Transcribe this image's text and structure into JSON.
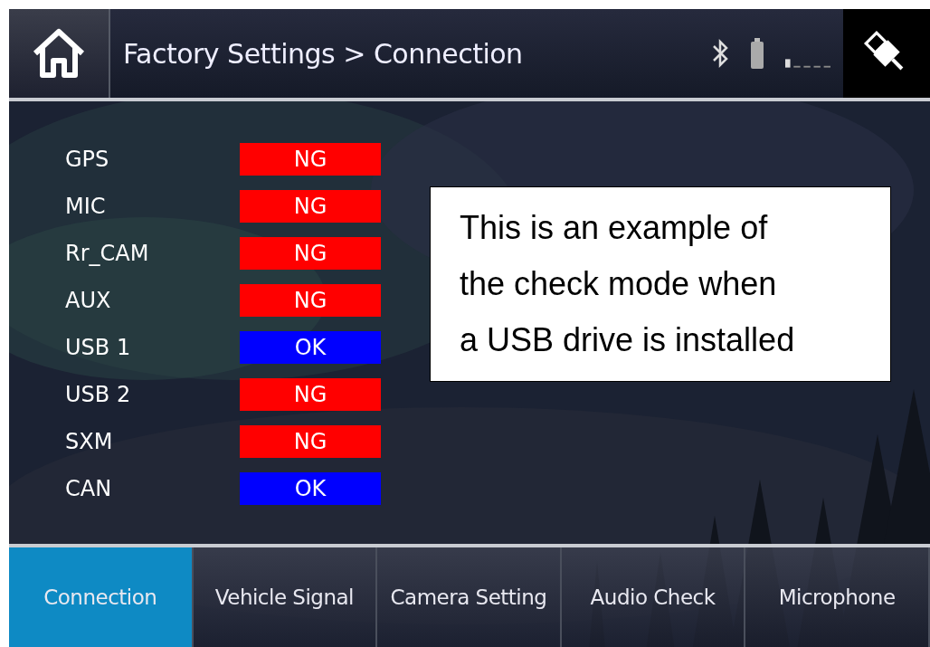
{
  "header": {
    "breadcrumb": "Factory Settings > Connection"
  },
  "checks": [
    {
      "label": "GPS",
      "status": "NG",
      "color": "#ff0000"
    },
    {
      "label": "MIC",
      "status": "NG",
      "color": "#ff0000"
    },
    {
      "label": "Rr_CAM",
      "status": "NG",
      "color": "#ff0000"
    },
    {
      "label": "AUX",
      "status": "NG",
      "color": "#ff0000"
    },
    {
      "label": "USB 1",
      "status": "OK",
      "color": "#0000ff"
    },
    {
      "label": "USB 2",
      "status": "NG",
      "color": "#ff0000"
    },
    {
      "label": "SXM",
      "status": "NG",
      "color": "#ff0000"
    },
    {
      "label": "CAN",
      "status": "OK",
      "color": "#0000ff"
    }
  ],
  "note": {
    "lines": [
      "This is an example of",
      "the check mode when",
      "a USB drive is installed"
    ]
  },
  "tabs": [
    {
      "label": "Connection",
      "selected": true
    },
    {
      "label": "Vehicle Signal",
      "selected": false
    },
    {
      "label": "Camera Setting",
      "selected": false
    },
    {
      "label": "Audio Check",
      "selected": false
    },
    {
      "label": "Microphone",
      "selected": false
    }
  ]
}
